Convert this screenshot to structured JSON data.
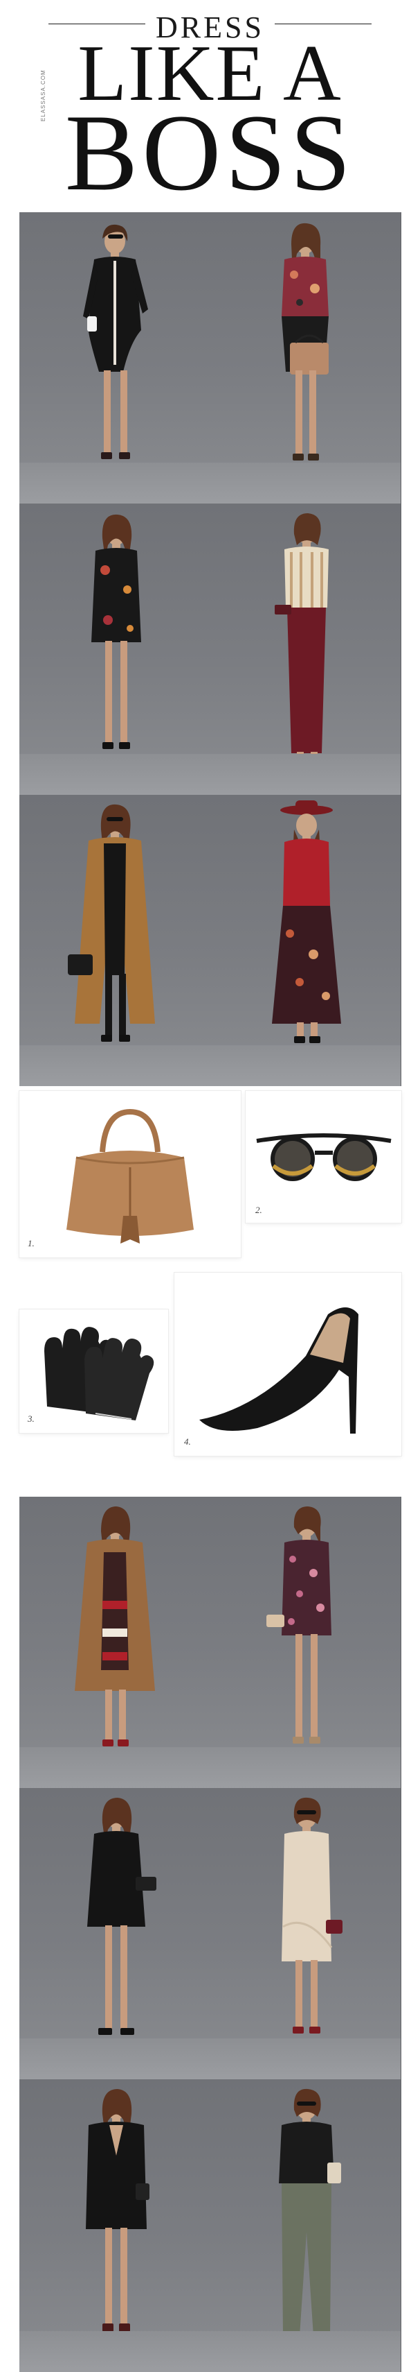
{
  "header": {
    "word_dress": "DRESS",
    "line_like": "LIKE A",
    "word_boss": "BOSS",
    "site": "ELASSASA.COM"
  },
  "accessories": [
    {
      "number": "1.",
      "icon": "tan-leather-bucket-bag-icon"
    },
    {
      "number": "2.",
      "icon": "round-tortoise-sunglasses-icon"
    },
    {
      "number": "3.",
      "icon": "black-leather-gloves-icon"
    },
    {
      "number": "4.",
      "icon": "black-suede-pump-icon"
    }
  ],
  "colors": {
    "backdrop": "#75777c",
    "skin": "#c89c7e",
    "hair": "#4a2c1c",
    "black": "#151515",
    "burgundy": "#6d1a25",
    "camel": "#a8743a",
    "red": "#b0202a",
    "olive": "#6b7261",
    "cream": "#e4d6c2"
  }
}
